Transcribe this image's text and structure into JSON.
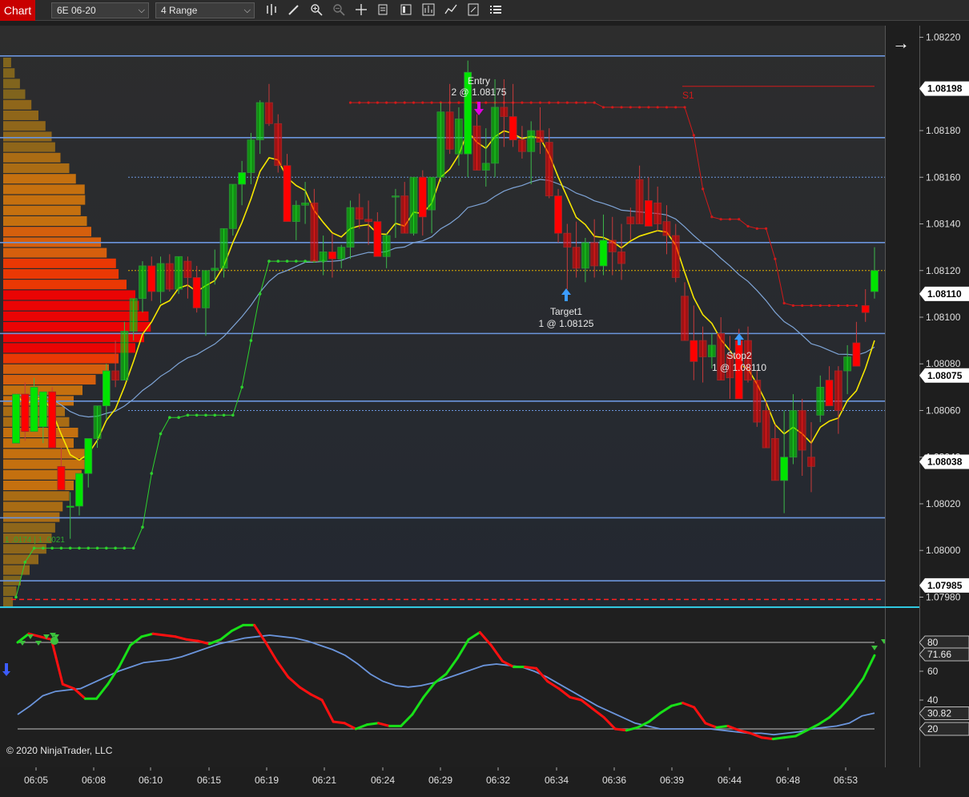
{
  "toolbar": {
    "tab_label": "Chart",
    "instrument": "6E 06-20",
    "bar_type": "4 Range",
    "icons": [
      "bars-icon",
      "draw-pencil-icon",
      "zoom-in-icon",
      "zoom-out-icon",
      "crosshair-icon",
      "data-box-icon",
      "properties-icon",
      "strategies-icon",
      "indicators-icon",
      "templates-icon",
      "menu-list-icon"
    ]
  },
  "colors": {
    "background_upper": "#2c2c2c",
    "background_lower": "#232830",
    "bull_candle": "#00e400",
    "bear_candle": "#ff0000",
    "level_line": "#6b95dc",
    "ema_yellow": "#f5e600",
    "stop_green": "#2ed12e",
    "stop_red": "#d11a1a"
  },
  "copyright": "© 2020 NinjaTrader, LLC",
  "chart_data": [
    {
      "type": "candlestick",
      "instrument": "6E 06-20",
      "bar_type": "4 Range",
      "ylim": [
        1.07975,
        1.08225
      ],
      "y_ticks": [
        "1.08220",
        "1.08180",
        "1.08160",
        "1.08140",
        "1.08120",
        "1.08100",
        "1.08080",
        "1.08060",
        "1.08040",
        "1.08020",
        "1.08000",
        "1.07980"
      ],
      "price_badges": [
        "1.08198",
        "1.08110",
        "1.08075",
        "1.08038",
        "1.07985"
      ],
      "level_lines": [
        1.08212,
        1.08177,
        1.08132,
        1.08093,
        1.08064,
        1.08014,
        1.07987
      ],
      "dotted_levels": [
        {
          "value": 1.0816,
          "label": "1.08160",
          "color": "#6b95dc"
        },
        {
          "value": 1.0812,
          "label": "1.08120",
          "color": "#e0b000"
        },
        {
          "value": 1.0806,
          "label": "1.08060",
          "color": "#6b95dc"
        }
      ],
      "x_labels": [
        "06:05",
        "06:08",
        "06:10",
        "06:15",
        "06:19",
        "06:21",
        "06:24",
        "06:29",
        "06:32",
        "06:34",
        "06:36",
        "06:39",
        "06:44",
        "06:48",
        "06:53"
      ],
      "candles": [
        [
          1.08046,
          1.08067,
          1.08046,
          1.08067
        ],
        [
          1.08067,
          1.08072,
          1.08047,
          1.08051
        ],
        [
          1.08051,
          1.08074,
          1.08051,
          1.0807
        ],
        [
          1.08053,
          1.08068,
          1.08046,
          1.08068
        ],
        [
          1.08068,
          1.0807,
          1.08044,
          1.08044
        ],
        [
          1.08036,
          1.08044,
          1.08026,
          1.08026
        ],
        [
          1.08019,
          1.08025,
          1.08005,
          1.08019
        ],
        [
          1.08019,
          1.08033,
          1.08015,
          1.08033
        ],
        [
          1.08033,
          1.08048,
          1.08027,
          1.08048
        ],
        [
          1.08048,
          1.08062,
          1.08044,
          1.08062
        ],
        [
          1.08062,
          1.0808,
          1.08056,
          1.08077
        ],
        [
          1.08077,
          1.0809,
          1.0807,
          1.08073
        ],
        [
          1.08073,
          1.08098,
          1.08073,
          1.08094
        ],
        [
          1.08094,
          1.08108,
          1.0809,
          1.08108
        ],
        [
          1.08108,
          1.08124,
          1.08102,
          1.08122
        ],
        [
          1.08122,
          1.08126,
          1.08107,
          1.08111
        ],
        [
          1.08111,
          1.08126,
          1.08106,
          1.08123
        ],
        [
          1.08123,
          1.08127,
          1.08111,
          1.08112
        ],
        [
          1.08112,
          1.08126,
          1.0811,
          1.08126
        ],
        [
          1.08124,
          1.08126,
          1.08108,
          1.08117
        ],
        [
          1.08117,
          1.08122,
          1.08102,
          1.08104
        ],
        [
          1.08104,
          1.0812,
          1.08092,
          1.0812
        ],
        [
          1.0812,
          1.08129,
          1.08114,
          1.08121
        ],
        [
          1.08121,
          1.08138,
          1.08117,
          1.08138
        ],
        [
          1.08138,
          1.08157,
          1.08135,
          1.08157
        ],
        [
          1.08157,
          1.08167,
          1.08148,
          1.08162
        ],
        [
          1.08162,
          1.08179,
          1.08157,
          1.08176
        ],
        [
          1.08176,
          1.08193,
          1.0817,
          1.08192
        ],
        [
          1.08192,
          1.082,
          1.08182,
          1.08183
        ],
        [
          1.08183,
          1.08187,
          1.08162,
          1.08165
        ],
        [
          1.08165,
          1.0817,
          1.08141,
          1.08141
        ],
        [
          1.08141,
          1.0815,
          1.08133,
          1.08148
        ],
        [
          1.08148,
          1.08158,
          1.0814,
          1.08149
        ],
        [
          1.08149,
          1.08155,
          1.08124,
          1.08124
        ],
        [
          1.08124,
          1.08135,
          1.08118,
          1.08128
        ],
        [
          1.08128,
          1.08136,
          1.08117,
          1.08125
        ],
        [
          1.08125,
          1.08131,
          1.08121,
          1.0813
        ],
        [
          1.0813,
          1.0815,
          1.08125,
          1.08147
        ],
        [
          1.08147,
          1.08153,
          1.08138,
          1.08142
        ],
        [
          1.08142,
          1.0815,
          1.08131,
          1.08141
        ],
        [
          1.08141,
          1.08145,
          1.08126,
          1.08126
        ],
        [
          1.08126,
          1.08136,
          1.08121,
          1.08135
        ],
        [
          1.08152,
          1.08155,
          1.08134,
          1.08152
        ],
        [
          1.08152,
          1.08158,
          1.08136,
          1.08136
        ],
        [
          1.08136,
          1.0816,
          1.08135,
          1.0816
        ],
        [
          1.0816,
          1.08163,
          1.08135,
          1.08143
        ],
        [
          1.08146,
          1.0816,
          1.08136,
          1.0816
        ],
        [
          1.0816,
          1.08192,
          1.08158,
          1.08188
        ],
        [
          1.08188,
          1.082,
          1.0817,
          1.08172
        ],
        [
          1.0817,
          1.0819,
          1.08165,
          1.08185
        ],
        [
          1.0817,
          1.0821,
          1.0816,
          1.08205
        ],
        [
          1.08182,
          1.08187,
          1.08163,
          1.08163
        ],
        [
          1.08163,
          1.08181,
          1.08156,
          1.08166
        ],
        [
          1.08166,
          1.08202,
          1.0816,
          1.0819
        ],
        [
          1.0819,
          1.08202,
          1.08173,
          1.08186
        ],
        [
          1.08186,
          1.082,
          1.08173,
          1.08176
        ],
        [
          1.08176,
          1.08182,
          1.08168,
          1.08171
        ],
        [
          1.08171,
          1.08184,
          1.08157,
          1.0818
        ],
        [
          1.0818,
          1.0819,
          1.0817,
          1.08175
        ],
        [
          1.08175,
          1.08181,
          1.08151,
          1.08152
        ],
        [
          1.08152,
          1.08155,
          1.08132,
          1.08136
        ],
        [
          1.08136,
          1.0814,
          1.08112,
          1.0813
        ],
        [
          1.0813,
          1.08141,
          1.08117,
          1.08121
        ],
        [
          1.08121,
          1.08134,
          1.08115,
          1.08132
        ],
        [
          1.08132,
          1.08142,
          1.08117,
          1.08122
        ],
        [
          1.08122,
          1.08144,
          1.08118,
          1.08133
        ],
        [
          1.08133,
          1.08143,
          1.08118,
          1.08128
        ],
        [
          1.08128,
          1.0814,
          1.08116,
          1.08123
        ],
        [
          1.08143,
          1.08147,
          1.08133,
          1.0814
        ],
        [
          1.08159,
          1.08165,
          1.0814,
          1.0814
        ],
        [
          1.0815,
          1.0816,
          1.08139,
          1.08139
        ],
        [
          1.08149,
          1.08156,
          1.08137,
          1.0814
        ],
        [
          1.08141,
          1.08148,
          1.08127,
          1.08135
        ],
        [
          1.08135,
          1.0814,
          1.08115,
          1.08117
        ],
        [
          1.08109,
          1.08115,
          1.0809,
          1.0809
        ],
        [
          1.0809,
          1.08105,
          1.08073,
          1.08081
        ],
        [
          1.0809,
          1.08096,
          1.08072,
          1.08083
        ],
        [
          1.08083,
          1.08093,
          1.08078,
          1.08088
        ],
        [
          1.08093,
          1.081,
          1.08073,
          1.08073
        ],
        [
          1.08084,
          1.08092,
          1.08065,
          1.08074
        ],
        [
          1.0809,
          1.08095,
          1.08065,
          1.08065
        ],
        [
          1.0809,
          1.08096,
          1.08072,
          1.08073
        ],
        [
          1.08073,
          1.08077,
          1.08053,
          1.08055
        ],
        [
          1.0806,
          1.08064,
          1.08044,
          1.08044
        ],
        [
          1.08048,
          1.08054,
          1.0803,
          1.0803
        ],
        [
          1.0803,
          1.0806,
          1.08016,
          1.0804
        ],
        [
          1.0804,
          1.08067,
          1.08037,
          1.0806
        ],
        [
          1.0806,
          1.08065,
          1.08032,
          1.08043
        ],
        [
          1.0804,
          1.08055,
          1.08025,
          1.08036
        ],
        [
          1.08058,
          1.08075,
          1.08055,
          1.0807
        ],
        [
          1.08073,
          1.08079,
          1.08062,
          1.08062
        ],
        [
          1.08077,
          1.08079,
          1.0805,
          1.0806
        ],
        [
          1.08077,
          1.08088,
          1.08067,
          1.08083
        ],
        [
          1.08089,
          1.08098,
          1.08079,
          1.08079
        ],
        [
          1.08105,
          1.08112,
          1.08098,
          1.08102
        ],
        [
          1.08111,
          1.0813,
          1.08108,
          1.0812
        ]
      ],
      "annotations": [
        {
          "label": "Entry",
          "detail": "2 @ 1.08175",
          "direction": "down",
          "color": "#e000e0"
        },
        {
          "label": "Target1",
          "detail": "1 @ 1.08125",
          "direction": "up",
          "color": "#3c9cff"
        },
        {
          "label": "Stop2",
          "detail": "1 @ 1.08110",
          "direction": "up",
          "color": "#3c9cff"
        },
        {
          "label": "S1",
          "color": "#d11a1a"
        },
        {
          "label": "1 .0174 | 1 .0021",
          "color": "#2ea82e"
        }
      ]
    },
    {
      "type": "line",
      "name": "oscillator",
      "ylim": [
        0,
        100
      ],
      "y_ticks": [
        "60",
        "40"
      ],
      "badges": [
        "80",
        "71.66",
        "30.82",
        "20"
      ],
      "levels": [
        80,
        20
      ],
      "series": [
        {
          "color": "#ff1010",
          "values": [
            80,
            86,
            84,
            82,
            51,
            48,
            41,
            41,
            51,
            63,
            78,
            84,
            86,
            85,
            84,
            82,
            81,
            79,
            82,
            88,
            92,
            92,
            80,
            67,
            56,
            49,
            44,
            40,
            25,
            24,
            20,
            23,
            24,
            22,
            22,
            30,
            42,
            52,
            58,
            69,
            82,
            87,
            78,
            67,
            63,
            63,
            62,
            53,
            48,
            42,
            40,
            34,
            28,
            20,
            19,
            21,
            25,
            31,
            36,
            38,
            35,
            24,
            21,
            22,
            19,
            17,
            14,
            13,
            14,
            15,
            19,
            23,
            28,
            35,
            44,
            55,
            71
          ]
        },
        {
          "color": "#6b95dc",
          "values": [
            30,
            36,
            43,
            46,
            47,
            48,
            52,
            56,
            60,
            63,
            66,
            67,
            68,
            70,
            73,
            76,
            79,
            81,
            83,
            84,
            85,
            84,
            83,
            81,
            78,
            75,
            71,
            65,
            58,
            53,
            50,
            49,
            50,
            52,
            55,
            58,
            61,
            64,
            65,
            64,
            63,
            60,
            56,
            51,
            46,
            41,
            36,
            32,
            28,
            24,
            22,
            20,
            20,
            20,
            20,
            20,
            19,
            18,
            17,
            17,
            16,
            17,
            18,
            20,
            21,
            22,
            24,
            29,
            31
          ]
        }
      ]
    }
  ]
}
